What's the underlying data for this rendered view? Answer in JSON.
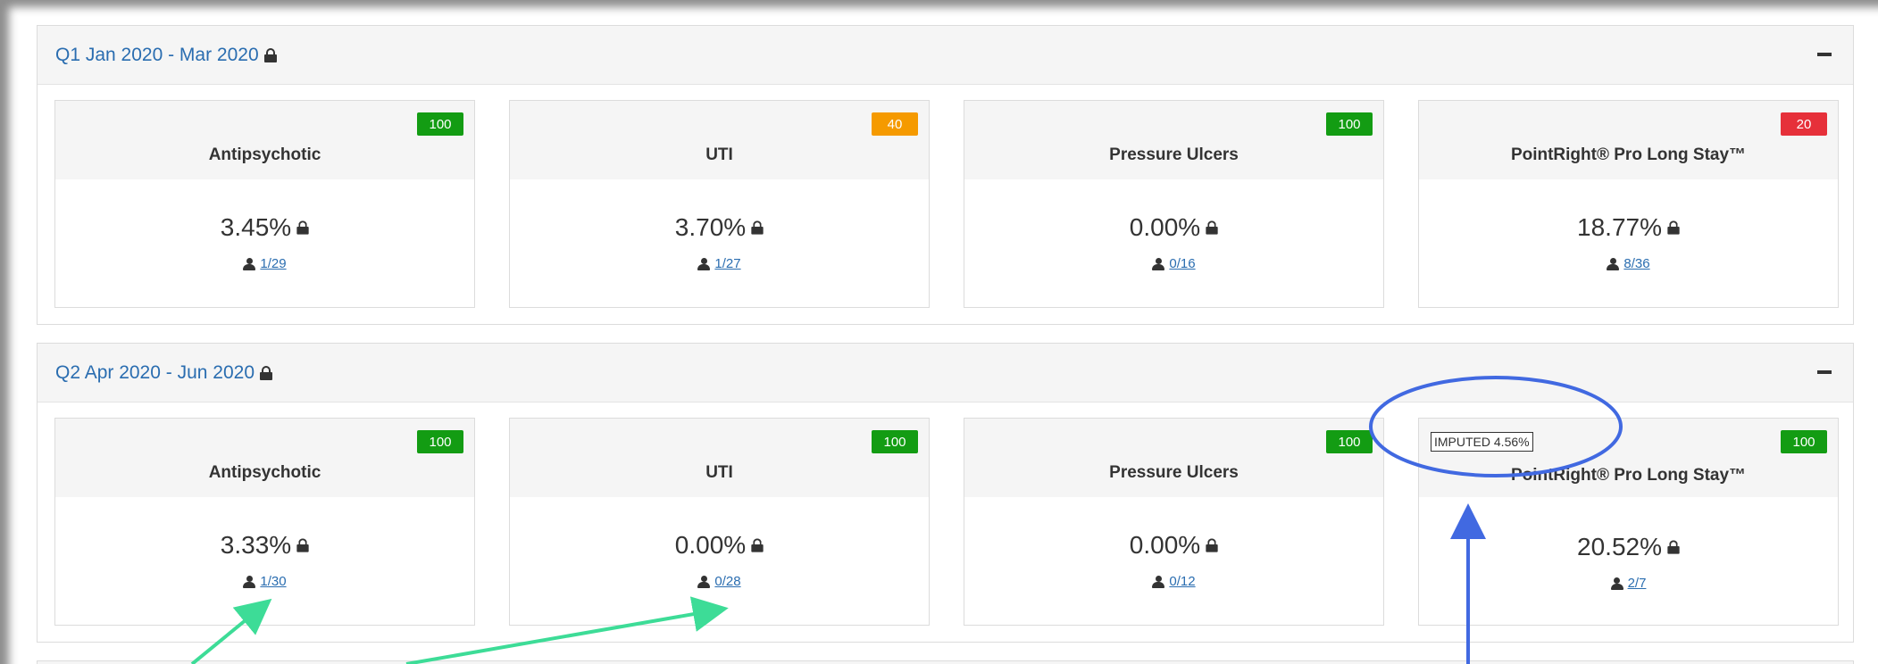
{
  "colors": {
    "green": "#139c13",
    "orange": "#f59a00",
    "red": "#e6303a",
    "link": "#2a6db0"
  },
  "sections": [
    {
      "title": "Q1 Jan 2020 - Mar 2020",
      "cards": [
        {
          "title": "Antipsychotic",
          "badge": "100",
          "badge_color": "#139c13",
          "value": "3.45%",
          "count": "1/29"
        },
        {
          "title": "UTI",
          "badge": "40",
          "badge_color": "#f59a00",
          "value": "3.70%",
          "count": "1/27"
        },
        {
          "title": "Pressure Ulcers",
          "badge": "100",
          "badge_color": "#139c13",
          "value": "0.00%",
          "count": "0/16"
        },
        {
          "title": "PointRight® Pro Long Stay™",
          "badge": "20",
          "badge_color": "#e6303a",
          "value": "18.77%",
          "count": "8/36"
        }
      ]
    },
    {
      "title": "Q2 Apr 2020 - Jun 2020",
      "cards": [
        {
          "title": "Antipsychotic",
          "badge": "100",
          "badge_color": "#139c13",
          "value": "3.33%",
          "count": "1/30"
        },
        {
          "title": "UTI",
          "badge": "100",
          "badge_color": "#139c13",
          "value": "0.00%",
          "count": "0/28"
        },
        {
          "title": "Pressure Ulcers",
          "badge": "100",
          "badge_color": "#139c13",
          "value": "0.00%",
          "count": "0/12"
        },
        {
          "title": "PointRight® Pro Long Stay™",
          "badge": "100",
          "badge_color": "#139c13",
          "value": "20.52%",
          "count": "2/7",
          "imputed": "IMPUTED 4.56%"
        }
      ]
    }
  ]
}
